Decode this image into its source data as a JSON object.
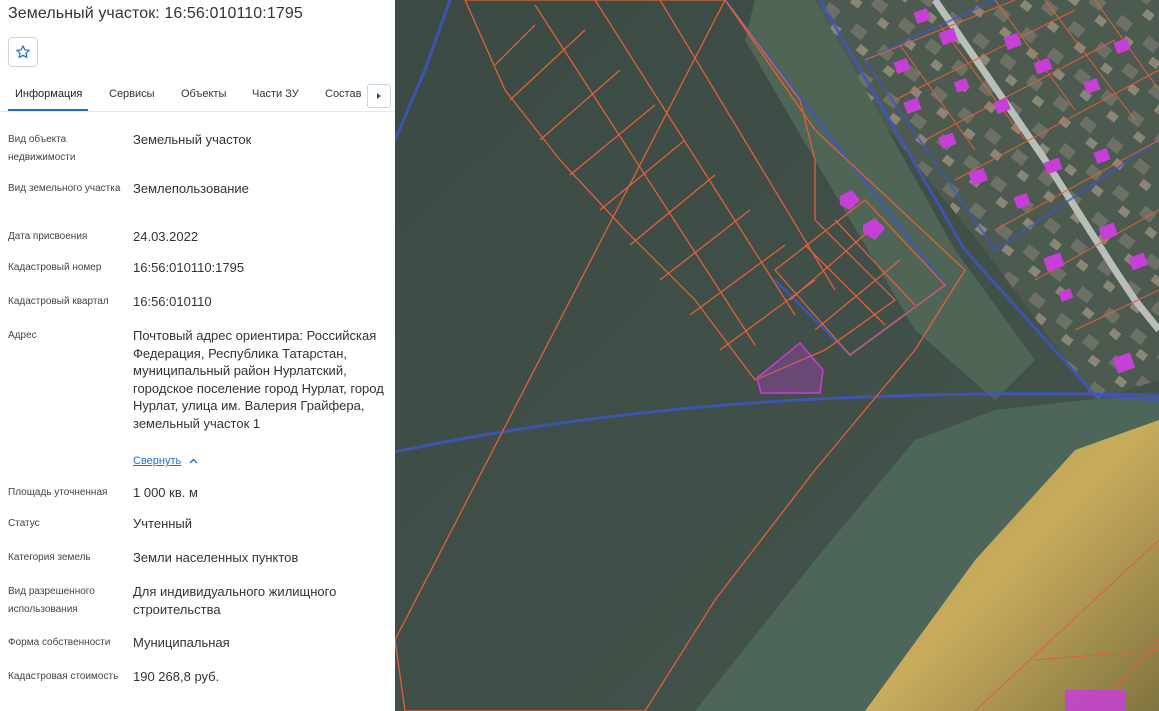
{
  "header": {
    "title": "Земельный участок: 16:56:010110:1795"
  },
  "favorite": {
    "icon": "star-icon"
  },
  "tabs": [
    {
      "label": "Информация",
      "active": true
    },
    {
      "label": "Сервисы",
      "active": false
    },
    {
      "label": "Объекты",
      "active": false
    },
    {
      "label": "Части ЗУ",
      "active": false
    },
    {
      "label": "Состав",
      "active": false
    }
  ],
  "tab_scroll_icon": "chevron-right-icon",
  "info": {
    "object_type": {
      "label": "Вид объекта недвижимости",
      "value": "Земельный участок"
    },
    "land_type": {
      "label": "Вид земельного участка",
      "value": "Землепользование"
    },
    "assign_date": {
      "label": "Дата присвоения",
      "value": "24.03.2022"
    },
    "cadastral_number": {
      "label": "Кадастровый номер",
      "value": "16:56:010110:1795"
    },
    "cadastral_quarter": {
      "label": "Кадастровый квартал",
      "value": "16:56:010110"
    },
    "address": {
      "label": "Адрес",
      "value": "Почтовый адрес ориентира: Российская Федерация, Республика Татарстан, муниципальный район Нурлатский, городское поселение город Нурлат, город Нурлат, улица им. Валерия Грайфера, земельный участок 1"
    },
    "collapse_label": "Свернуть",
    "area": {
      "label": "Площадь уточненная",
      "value": "1 000 кв. м"
    },
    "status": {
      "label": "Статус",
      "value": "Учтенный"
    },
    "category": {
      "label": "Категория земель",
      "value": "Земли населенных пунктов"
    },
    "permitted_use": {
      "label": "Вид разрешенного использования",
      "value": "Для индивидуального жилищного строительства"
    },
    "ownership": {
      "label": "Форма собственности",
      "value": "Муниципальная"
    },
    "cadastral_value": {
      "label": "Кадастровая стоимость",
      "value": "190 268,8 руб."
    }
  },
  "colors": {
    "accent": "#1d6fce",
    "parcel_border": "#e0603a",
    "quarter_border": "#3d55c8",
    "building": "#c63fd6",
    "selected_parcel": "#b23dc6"
  }
}
